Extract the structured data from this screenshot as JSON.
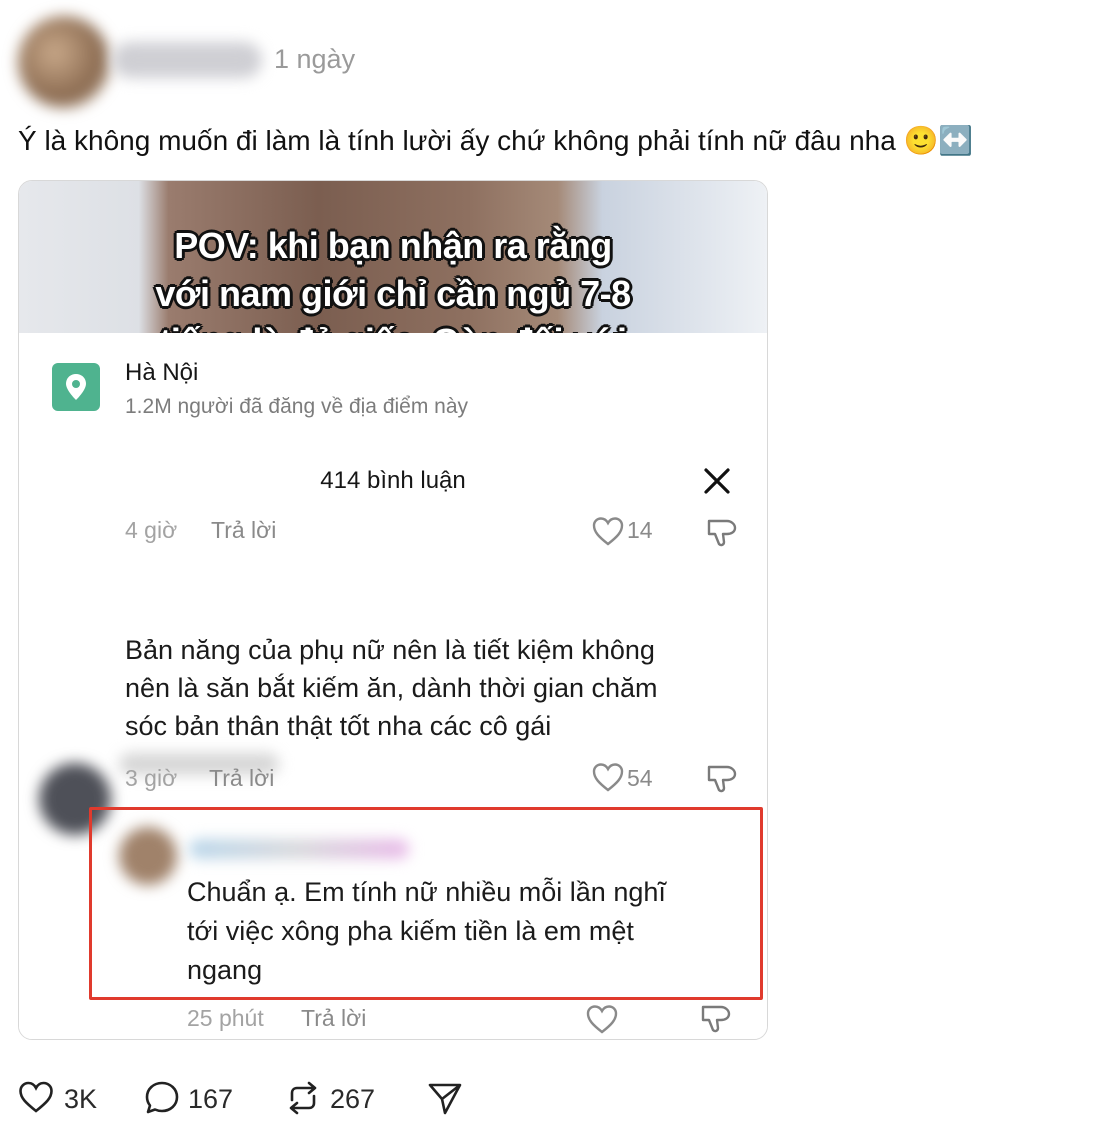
{
  "post": {
    "time": "1 ngày",
    "text": "Ý là không muốn đi làm là tính lười ấy chứ không phải tính nữ đâu nha 🙂↔️"
  },
  "screenshot": {
    "video_caption": [
      "POV: khi bạn nhận ra rằng",
      "với nam giới chỉ cần ngủ 7-8",
      "tiếng là đủ giấc. Còn đối với"
    ],
    "location": {
      "name": "Hà Nội",
      "subtitle": "1.2M người đã đăng về địa điểm này"
    },
    "comments_header": "414 bình luận",
    "top_row": {
      "time": "4 giờ",
      "reply": "Trả lời",
      "likes": "14"
    },
    "comment1": {
      "lines": [
        "Bản năng của phụ nữ nên là tiết kiệm không",
        "nên là săn bắt kiếm ăn, dành thời gian chăm",
        "sóc bản thân thật tốt nha các cô gái"
      ],
      "time": "3 giờ",
      "reply": "Trả lời",
      "likes": "54"
    },
    "comment2": {
      "lines": [
        "Chuẩn ạ. Em tính nữ nhiều mỗi lần nghĩ",
        "tới việc xông pha kiếm tiền là em mệt",
        "ngang"
      ],
      "time": "25 phút",
      "reply": "Trả lời"
    }
  },
  "actions": {
    "likes": "3K",
    "comments": "167",
    "reposts": "267"
  },
  "colors": {
    "highlight": "#e03a2d",
    "location_icon": "#4fb38f"
  }
}
